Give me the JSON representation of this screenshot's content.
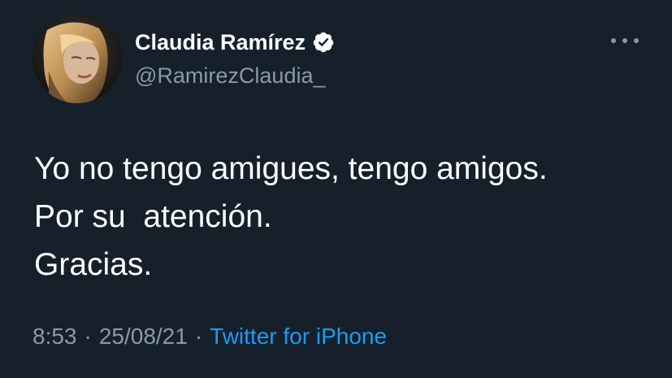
{
  "user": {
    "display_name": "Claudia Ramírez",
    "handle": "@RamirezClaudia_",
    "verified": true
  },
  "tweet": {
    "lines": [
      "Yo no tengo amigues, tengo amigos.",
      "Por su  atención.",
      "Gracias."
    ],
    "time": "8:53",
    "date": "25/08/21",
    "separator": "·",
    "source": "Twitter for iPhone"
  },
  "icons": {
    "verified": "verified-badge-icon",
    "more": "more-options-icon"
  },
  "colors": {
    "background": "#15202b",
    "text": "#ffffff",
    "secondary": "#8b98a5",
    "accent": "#1d9bf0"
  }
}
